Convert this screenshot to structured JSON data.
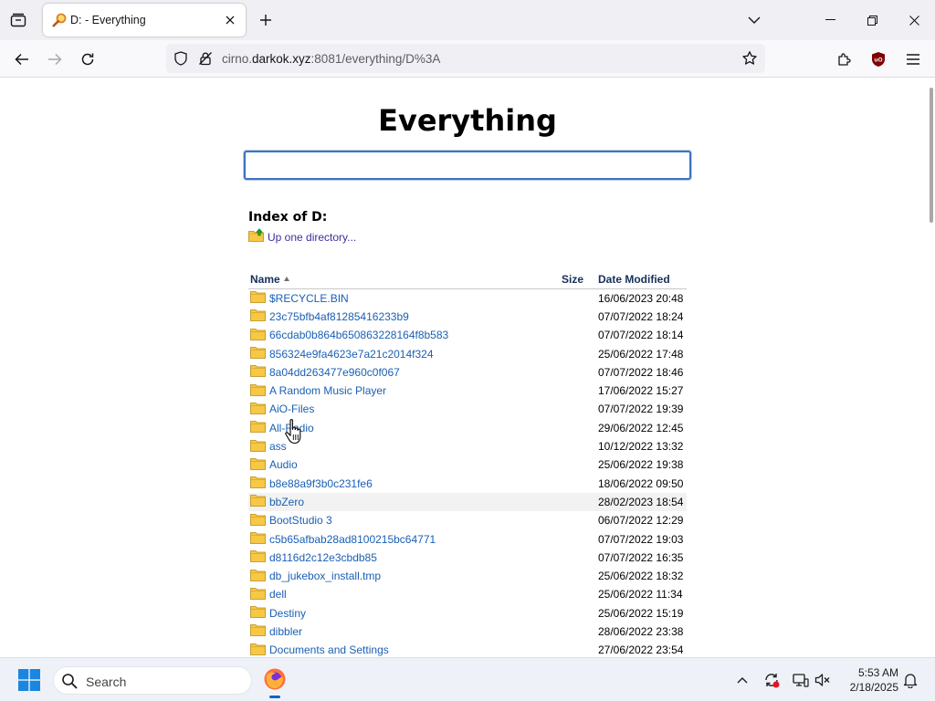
{
  "browser": {
    "tab": {
      "title": "D: - Everything"
    },
    "url": {
      "host_prefix": "cirno.",
      "host": "darkok.xyz",
      "rest": ":8081/everything/D%3A"
    }
  },
  "page": {
    "title": "Everything",
    "search_value": "",
    "index_title": "Index of D:",
    "up_directory_label": "Up one directory...",
    "columns": {
      "name": "Name",
      "size": "Size",
      "date": "Date Modified"
    },
    "sort": {
      "column": "name",
      "direction": "ascending"
    },
    "rows": [
      {
        "name": "$RECYCLE.BIN",
        "size": "",
        "date": "16/06/2023 20:48"
      },
      {
        "name": "23c75bfb4af81285416233b9",
        "size": "",
        "date": "07/07/2022 18:24"
      },
      {
        "name": "66cdab0b864b650863228164f8b583",
        "size": "",
        "date": "07/07/2022 18:14"
      },
      {
        "name": "856324e9fa4623e7a21c2014f324",
        "size": "",
        "date": "25/06/2022 17:48"
      },
      {
        "name": "8a04dd263477e960c0f067",
        "size": "",
        "date": "07/07/2022 18:46"
      },
      {
        "name": "A Random Music Player",
        "size": "",
        "date": "17/06/2022 15:27"
      },
      {
        "name": "AiO-Files",
        "size": "",
        "date": "07/07/2022 19:39"
      },
      {
        "name": "All-Radio",
        "size": "",
        "date": "29/06/2022 12:45"
      },
      {
        "name": "ass",
        "size": "",
        "date": "10/12/2022 13:32"
      },
      {
        "name": "Audio",
        "size": "",
        "date": "25/06/2022 19:38"
      },
      {
        "name": "b8e88a9f3b0c231fe6",
        "size": "",
        "date": "18/06/2022 09:50"
      },
      {
        "name": "bbZero",
        "size": "",
        "date": "28/02/2023 18:54"
      },
      {
        "name": "BootStudio 3",
        "size": "",
        "date": "06/07/2022 12:29"
      },
      {
        "name": "c5b65afbab28ad8100215bc64771",
        "size": "",
        "date": "07/07/2022 19:03"
      },
      {
        "name": "d8116d2c12e3cbdb85",
        "size": "",
        "date": "07/07/2022 16:35"
      },
      {
        "name": "db_jukebox_install.tmp",
        "size": "",
        "date": "25/06/2022 18:32"
      },
      {
        "name": "dell",
        "size": "",
        "date": "25/06/2022 11:34"
      },
      {
        "name": "Destiny",
        "size": "",
        "date": "25/06/2022 15:19"
      },
      {
        "name": "dibbler",
        "size": "",
        "date": "28/06/2022 23:38"
      },
      {
        "name": "Documents and Settings",
        "size": "",
        "date": "27/06/2022 23:54"
      }
    ],
    "hovered_row_index": 11
  },
  "taskbar": {
    "search_placeholder": "Search",
    "time": "5:53 AM",
    "date": "2/18/2025"
  },
  "colors": {
    "link": "#1a5fb4",
    "up_link": "#3c2f9e",
    "search_border": "#3d73bf",
    "folder": "#f6c846",
    "tab_bar": "#f0f0f4"
  },
  "icons": {
    "tab": "everything-magnifier-icon",
    "folder": "folder-icon",
    "up_directory": "folder-up-icon"
  }
}
